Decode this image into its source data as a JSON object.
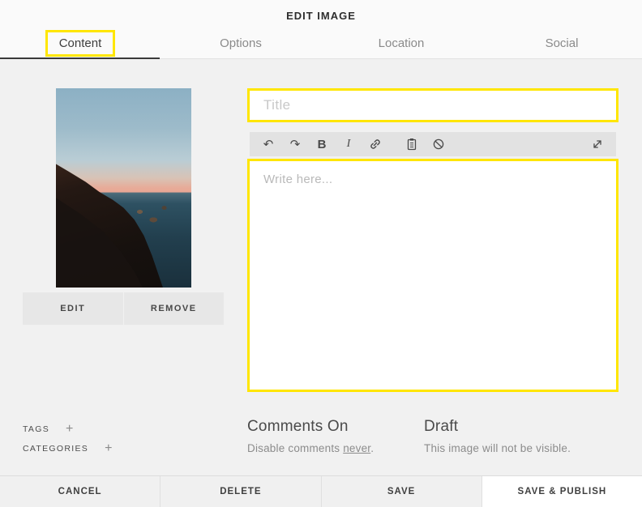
{
  "window": {
    "title": "EDIT IMAGE"
  },
  "tabs": [
    {
      "label": "Content",
      "active": true,
      "highlighted": true
    },
    {
      "label": "Options",
      "active": false
    },
    {
      "label": "Location",
      "active": false
    },
    {
      "label": "Social",
      "active": false
    }
  ],
  "image_panel": {
    "photo_description": "coastal-cliffs-sunset-photo",
    "edit_button": "EDIT",
    "remove_button": "REMOVE"
  },
  "editor": {
    "title_placeholder": "Title",
    "body_placeholder": "Write here...",
    "toolbar": {
      "undo_glyph": "↶",
      "redo_glyph": "↷",
      "bold_glyph": "B",
      "italic_glyph": "I",
      "icon_names": [
        "undo-icon",
        "redo-icon",
        "bold-icon",
        "italic-icon",
        "link-icon",
        "clipboard-icon",
        "no-style-icon",
        "expand-icon"
      ]
    }
  },
  "metadata": {
    "tags_label": "TAGS",
    "categories_label": "CATEGORIES",
    "add_glyph": "+"
  },
  "comments": {
    "heading": "Comments On",
    "text_prefix": "Disable comments ",
    "link_text": "never",
    "text_suffix": "."
  },
  "status": {
    "heading": "Draft",
    "description": "This image will not be visible."
  },
  "footer": {
    "cancel": "CANCEL",
    "delete": "DELETE",
    "save": "SAVE",
    "save_publish": "SAVE & PUBLISH"
  },
  "colors": {
    "highlight_yellow": "#ffe600",
    "toolbar_bg": "#e2e2e2",
    "header_bg": "#fafafa",
    "content_bg": "#f1f1f1",
    "active_tab_text": "#3d3d3d",
    "inactive_tab_text": "#8a8a8a"
  }
}
